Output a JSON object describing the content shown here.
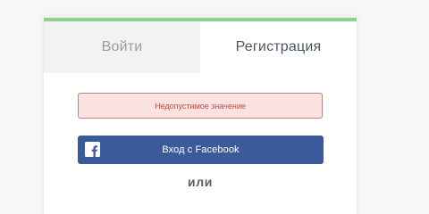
{
  "colors": {
    "accent_bar": "#8fd18f",
    "facebook_blue": "#3b5a9a",
    "error_bg": "#fbe2e0",
    "error_border": "#b9877f",
    "error_text": "#b9504a"
  },
  "tabs": {
    "login_label": "Войти",
    "register_label": "Регистрация",
    "active": "register"
  },
  "alert": {
    "message": "Недопустимое значение"
  },
  "facebook": {
    "label": "Вход с Facebook",
    "icon": "facebook-icon"
  },
  "divider": {
    "or_label": "или"
  }
}
